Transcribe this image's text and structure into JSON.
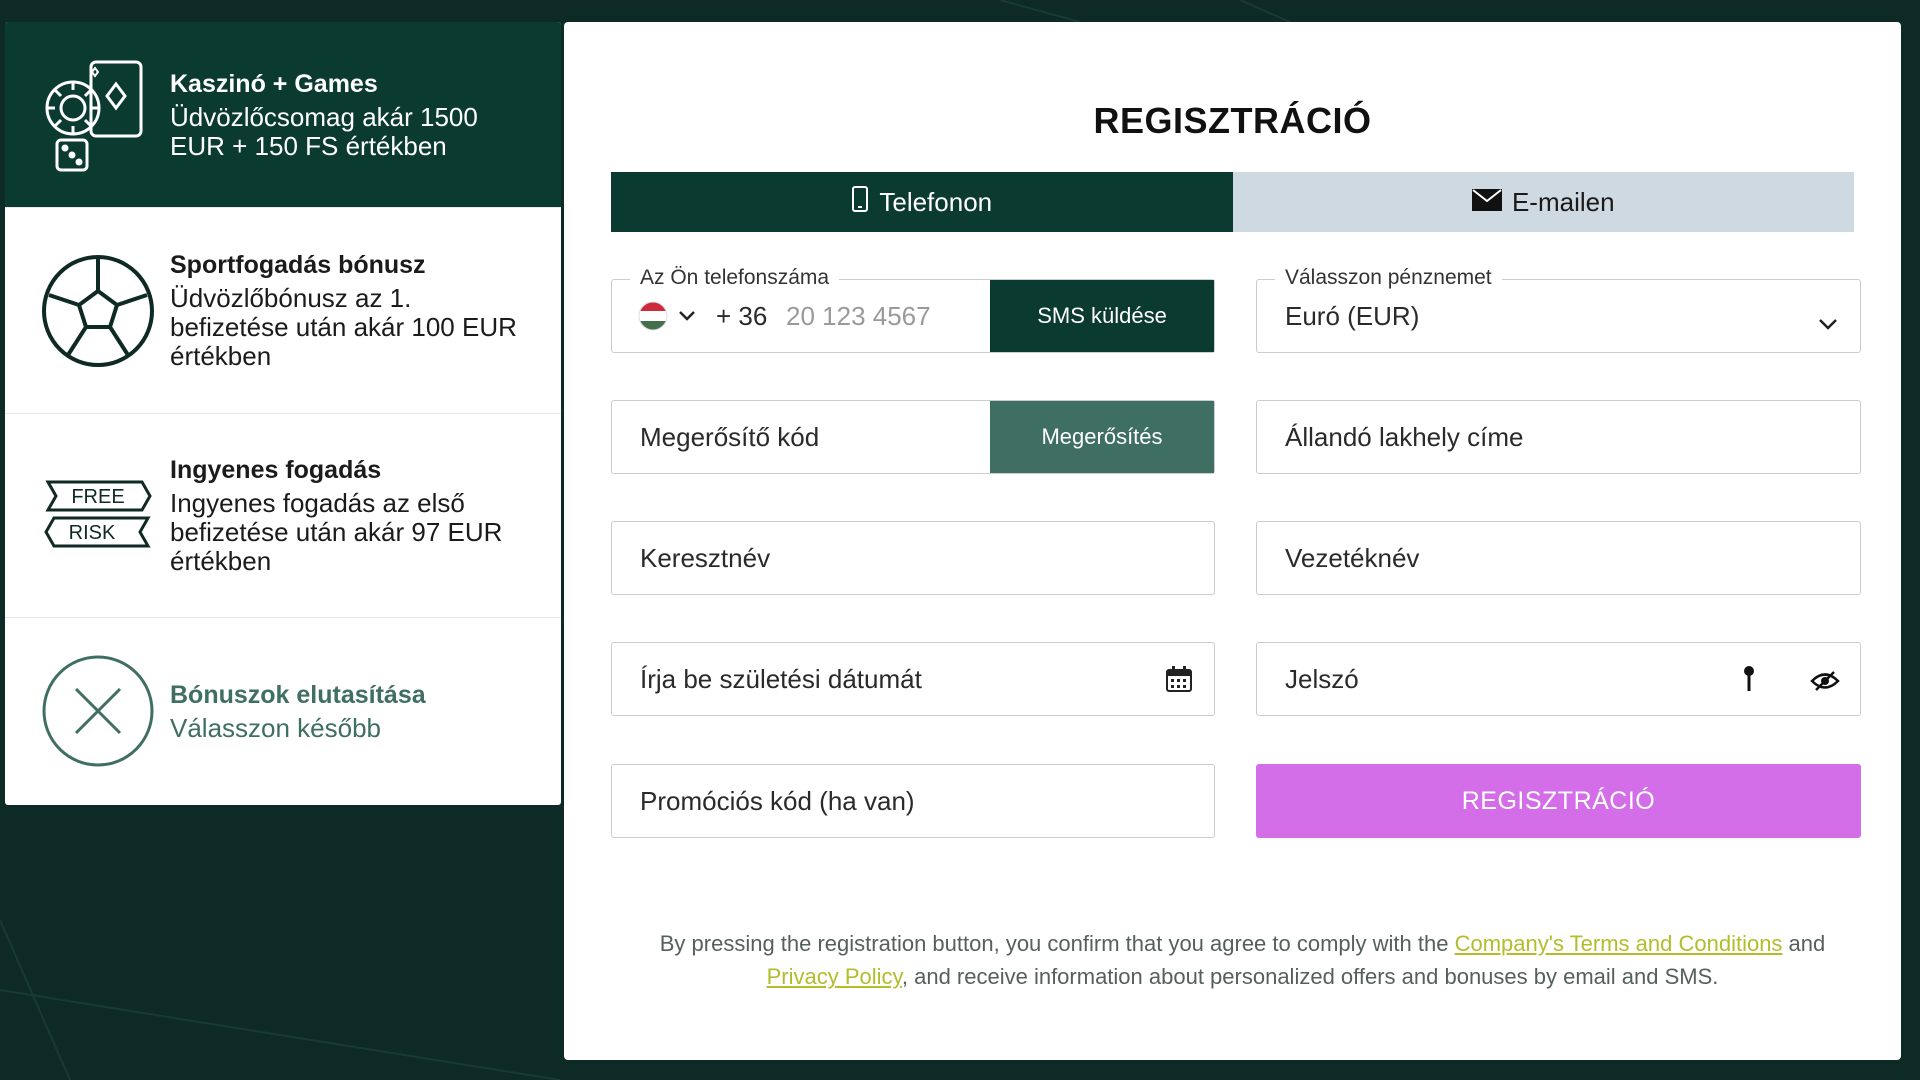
{
  "bonuses": [
    {
      "title": "Kaszinó + Games",
      "desc": "Üdvözlőcsomag akár 1500 EUR + 150 FS értékben",
      "icon": "casino-chips-cards-icon",
      "selected": true
    },
    {
      "title": "Sportfogadás bónusz",
      "desc": "Üdvözlőbónusz az 1. befizetése után akár 100 EUR értékben",
      "icon": "soccer-ball-icon",
      "selected": false
    },
    {
      "title": "Ingyenes fogadás",
      "desc": "Ingyenes fogadás az első befizetése után akár 97 EUR értékben",
      "icon": "free-risk-ticket-icon",
      "icon_text": [
        "FREE",
        "RISK"
      ],
      "selected": false
    },
    {
      "title": "Bónuszok elutasítása",
      "desc": "Válasszon később",
      "icon": "close-circle-icon",
      "selected": false
    }
  ],
  "registration": {
    "title": "REGISZTRÁCIÓ",
    "tabs": [
      {
        "label": "Telefonon",
        "icon": "phone-icon",
        "active": true
      },
      {
        "label": "E-mailen",
        "icon": "envelope-icon",
        "active": false
      }
    ],
    "phone": {
      "legend": "Az Ön telefonszáma",
      "country_flag": "hungary-flag-icon",
      "prefix": "+ 36",
      "placeholder": "20 123 4567",
      "send_button": "SMS küldése"
    },
    "currency": {
      "legend": "Válasszon pénznemet",
      "value": "Euró (EUR)"
    },
    "confirm_code": {
      "placeholder": "Megerősítő kód",
      "button": "Megerősítés"
    },
    "address": {
      "placeholder": "Állandó lakhely címe"
    },
    "first_name": {
      "placeholder": "Keresztnév"
    },
    "last_name": {
      "placeholder": "Vezetéknév"
    },
    "birthdate": {
      "placeholder": "Írja be születési dátumát"
    },
    "password": {
      "placeholder": "Jelszó"
    },
    "promo": {
      "placeholder": "Promóciós kód (ha van)"
    },
    "submit": "REGISZTRÁCIÓ",
    "legal": {
      "before": "By pressing the registration button, you confirm that you agree to comply with the ",
      "terms_link": "Company's Terms and Conditions",
      "middle": " and ",
      "privacy_link": "Privacy Policy",
      "after": ", and receive information about personalized offers and bonuses by email and SMS."
    }
  },
  "colors": {
    "dark_green": "#0b3a31",
    "muted_green": "#3f6e63",
    "tab_inactive": "#cfd9e2",
    "register_button": "#d36ee8",
    "link": "#b3bd2a",
    "background": "#0d2a26"
  }
}
